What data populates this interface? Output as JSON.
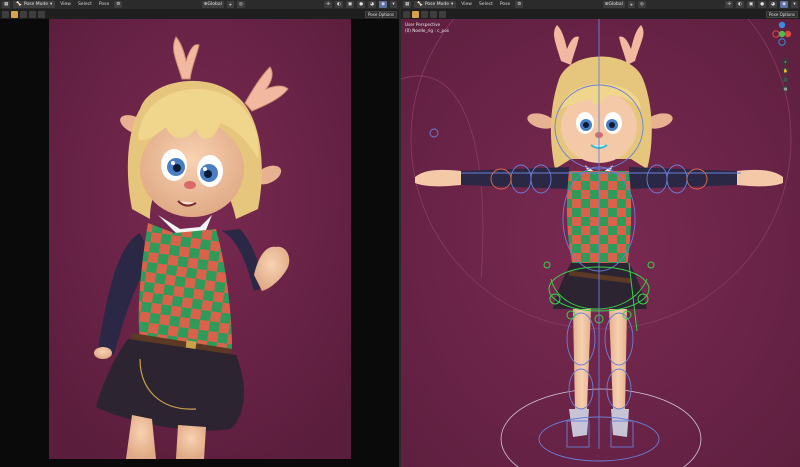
{
  "left_editor": {
    "mode": "Pose Mode",
    "menus": [
      "View",
      "Select",
      "Pose"
    ],
    "pivot": "Global",
    "options_label": "Pose Options"
  },
  "right_editor": {
    "mode": "Pose Mode",
    "menus": [
      "View",
      "Select",
      "Pose"
    ],
    "pivot": "Global",
    "options_label": "Pose Options",
    "view_label": "User Perspective",
    "object_label": "(0) Noelle_rig : c_pos"
  },
  "colors": {
    "background_magenta": "#6b2447",
    "letterbox": "#0a0a0a",
    "header": "#2b2b2b",
    "active_tool": "#d8a24a",
    "bone_blue": "#6b7fd6",
    "bone_green": "#3ad04a"
  },
  "icons": [
    "pose-mode-icon",
    "view-menu",
    "transform-pivot-icon",
    "snap-icon",
    "proportional-icon",
    "overlay-icon",
    "shading-icon",
    "axis-gizmo",
    "zoom-icon",
    "hand-icon",
    "camera-icon"
  ]
}
